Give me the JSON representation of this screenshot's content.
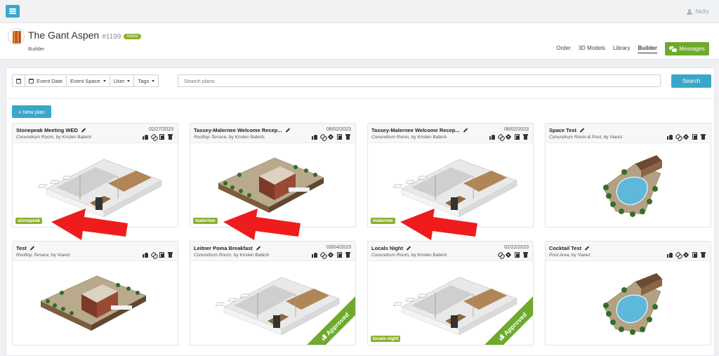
{
  "topbar": {
    "user_name": "Nicky"
  },
  "header": {
    "title": "The Gant Aspen",
    "number": "#1199",
    "status": "Active",
    "subtitle": "Builder",
    "nav": [
      "Order",
      "3D Models",
      "Library",
      "Builder"
    ],
    "active_nav": "Builder",
    "messages_label": "Messages"
  },
  "filters": {
    "event_date": "Event Date",
    "event_space": "Event Space",
    "user": "User",
    "tags": "Tags",
    "search_placeholder": "Search plans",
    "search_label": "Search",
    "new_plan_label": "+ New plan"
  },
  "cards": [
    {
      "title": "Stonepeak Meeting WED",
      "date": "02/27/2023",
      "room": "Conundrum Room,",
      "by": " by Kristen Babich",
      "tag": "stonepeak",
      "approved": false,
      "plan": "indoor",
      "actions": [
        "like",
        "link",
        "copy",
        "trash"
      ]
    },
    {
      "title": "Tassey-Malernee Welcome Recep...",
      "date": "06/02/2023",
      "room": "Rooftop Terrace,",
      "by": " by Kristen Babich",
      "tag": "malernee",
      "approved": false,
      "plan": "terrace",
      "actions": [
        "like",
        "link",
        "tags",
        "copy",
        "trash"
      ]
    },
    {
      "title": "Tassey-Malernee Welcome Recep...",
      "date": "06/02/2023",
      "room": "Conundrum Room,",
      "by": " by Kristen Babich",
      "tag": "malernee",
      "approved": false,
      "plan": "indoor",
      "actions": [
        "like",
        "link",
        "tags",
        "copy",
        "trash"
      ]
    },
    {
      "title": "Space Test",
      "date": "",
      "room": "Conundrum Room & Pool,",
      "by": " by Viarez",
      "tag": "",
      "approved": false,
      "plan": "pool",
      "actions": [
        "like",
        "link",
        "tags",
        "copy",
        "trash"
      ]
    },
    {
      "title": "Test",
      "date": "",
      "room": "Rooftop Terrace,",
      "by": " by Viarez",
      "tag": "",
      "approved": false,
      "plan": "terrace",
      "actions": [
        "like",
        "link",
        "copy",
        "trash"
      ]
    },
    {
      "title": "Leitner Poma Breakfast",
      "date": "03/04/2023",
      "room": "Conundrum Room,",
      "by": " by Kristen Babich",
      "tag": "",
      "approved": true,
      "plan": "indoor",
      "actions": [
        "like",
        "link",
        "tags",
        "copy",
        "trash"
      ]
    },
    {
      "title": "Locals Night",
      "date": "02/22/2023",
      "room": "Conundrum Room,",
      "by": " by Kristen Babich",
      "tag": "locals-night",
      "approved": true,
      "plan": "indoor",
      "actions": [
        "link",
        "tags",
        "copy",
        "trash"
      ]
    },
    {
      "title": "Cocktail Test",
      "date": "",
      "room": "Pool Area,",
      "by": " by Viarez",
      "tag": "",
      "approved": false,
      "plan": "pool",
      "actions": [
        "like",
        "link",
        "tags",
        "copy",
        "trash"
      ]
    }
  ],
  "approved_label": "Approved",
  "colors": {
    "primary": "#3ca6c9",
    "success": "#6eaa2c",
    "tag": "#8bb22c",
    "annotation": "#ee1c1c"
  },
  "annotations": {
    "arrows_pointing_at_tags": 3
  }
}
